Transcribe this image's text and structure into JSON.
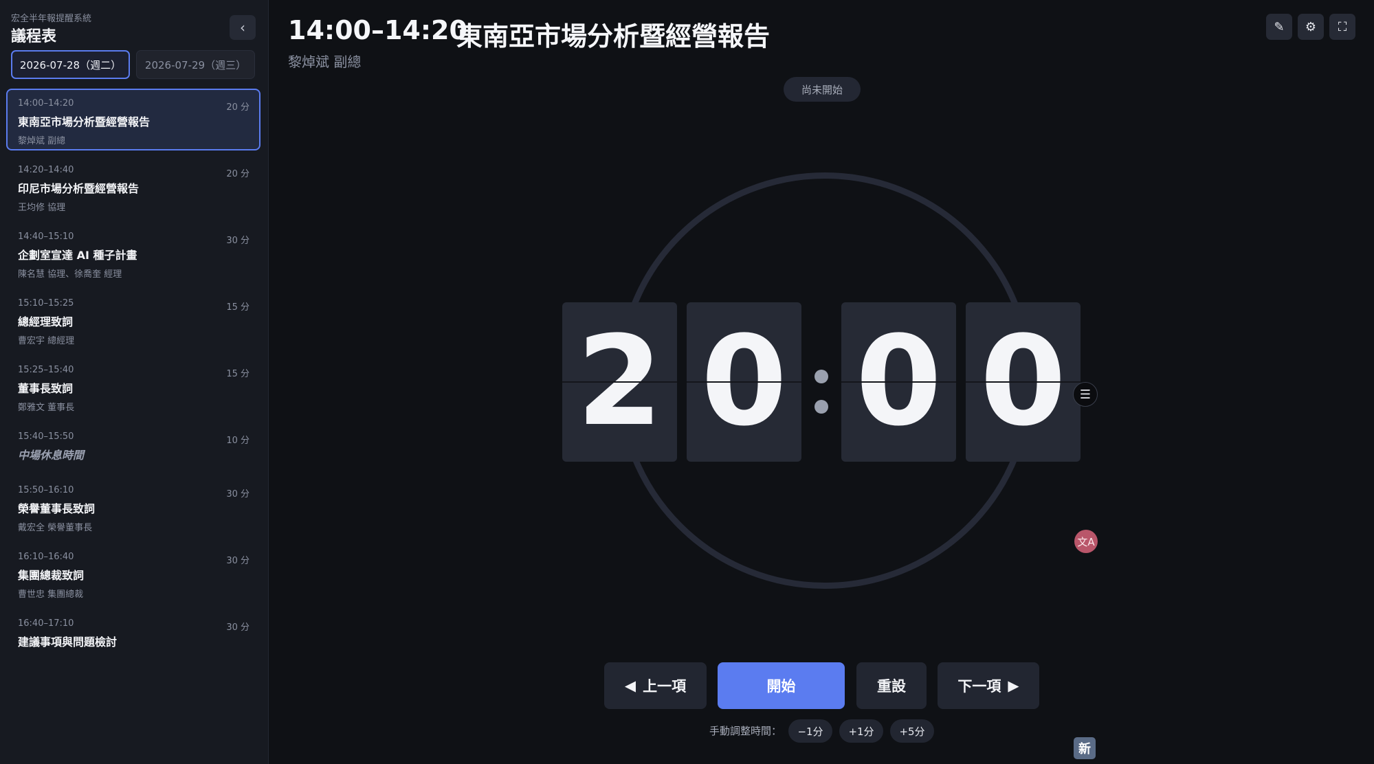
{
  "sidebar": {
    "subtitle": "宏全半年報提醒系統",
    "title": "議程表",
    "collapse_icon": "‹",
    "dates": [
      {
        "label": "2026-07-28（週二）",
        "active": true
      },
      {
        "label": "2026-07-29（週三）",
        "active": false
      }
    ],
    "items": [
      {
        "time": "14:00–14:20",
        "duration": "20 分",
        "title": "東南亞市場分析暨經營報告",
        "speaker": "黎焯斌 副總"
      },
      {
        "time": "14:20–14:40",
        "duration": "20 分",
        "title": "印尼市場分析暨經營報告",
        "speaker": "王均修 協理"
      },
      {
        "time": "14:40–15:10",
        "duration": "30 分",
        "title": "企劃室宣達 AI 種子計畫",
        "speaker": "陳名慧 協理、徐喬奎 經理"
      },
      {
        "time": "15:10–15:25",
        "duration": "15 分",
        "title": "總經理致詞",
        "speaker": "曹宏宇 總經理"
      },
      {
        "time": "15:25–15:40",
        "duration": "15 分",
        "title": "董事長致詞",
        "speaker": "鄭雅文 董事長"
      },
      {
        "time": "15:40–15:50",
        "duration": "10 分",
        "title": "中場休息時間",
        "speaker": ""
      },
      {
        "time": "15:50–16:10",
        "duration": "30 分",
        "title": "榮譽董事長致詞",
        "speaker": "戴宏全 榮譽董事長"
      },
      {
        "time": "16:10–16:40",
        "duration": "30 分",
        "title": "集團總裁致詞",
        "speaker": "曹世忠 集團總裁"
      },
      {
        "time": "16:40–17:10",
        "duration": "30 分",
        "title": "建議事項與問題檢討",
        "speaker": ""
      }
    ]
  },
  "header": {
    "time": "14:00–14:20",
    "title": "東南亞市場分析暨經營報告",
    "speaker": "黎焯斌 副總",
    "tools": {
      "edit": "✎",
      "settings": "⚙",
      "fullscreen": "⛶"
    }
  },
  "timer": {
    "status": "尚未開始",
    "digits": [
      "2",
      "0",
      "0",
      "0"
    ]
  },
  "controls": {
    "prev_icon": "◀",
    "prev": "上一項",
    "start": "開始",
    "reset": "重設",
    "next": "下一項",
    "next_icon": "▶",
    "adjust_label": "手動調整時間：",
    "adjust": [
      "−1分",
      "+1分",
      "+5分"
    ]
  },
  "floating": {
    "menu_icon": "☰",
    "translate_icon": "文A",
    "new_badge": "新"
  },
  "colors": {
    "accent": "#5b7cf0",
    "background": "#0f1115",
    "sidebar": "#171a21",
    "card": "#262a35"
  }
}
